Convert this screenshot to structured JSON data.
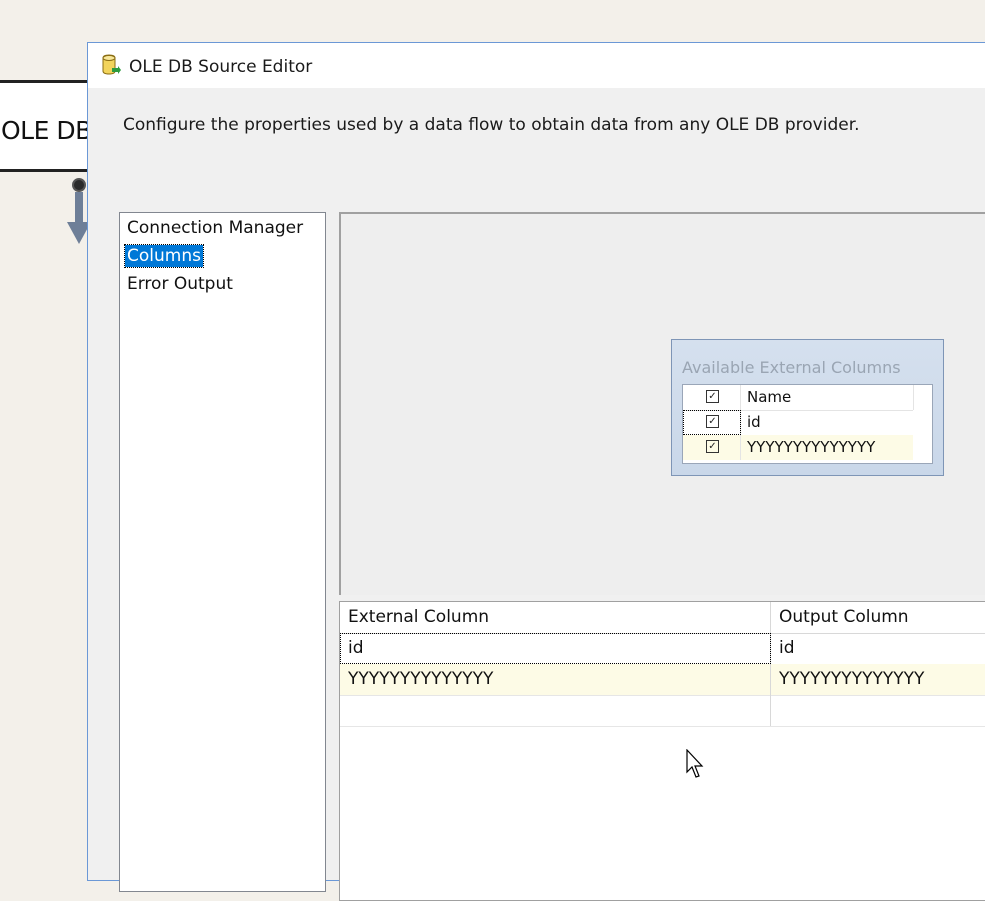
{
  "background": {
    "node_label": "OLE DB S"
  },
  "dialog": {
    "title": "OLE DB Source Editor",
    "title_icon": "database-source-icon",
    "description": "Configure the properties used by a data flow to obtain data from any OLE DB provider."
  },
  "nav": {
    "items": [
      {
        "label": "Connection Manager",
        "selected": false
      },
      {
        "label": "Columns",
        "selected": true
      },
      {
        "label": "Error Output",
        "selected": false
      }
    ]
  },
  "available_columns": {
    "title": "Available External Columns",
    "header": "Name",
    "rows": [
      {
        "name": "id",
        "checked": true
      },
      {
        "name": "YYYYYYYYYYYYYY",
        "checked": true
      }
    ]
  },
  "mapping_grid": {
    "headers": [
      "External Column",
      "Output Column"
    ],
    "rows": [
      {
        "external": "id",
        "output": "id"
      },
      {
        "external": "YYYYYYYYYYYYYY",
        "output": "YYYYYYYYYYYYYY"
      }
    ]
  },
  "colors": {
    "selection": "#0078d7",
    "dialog_border": "#6b98d6",
    "alt_row": "#fdfbe6"
  }
}
